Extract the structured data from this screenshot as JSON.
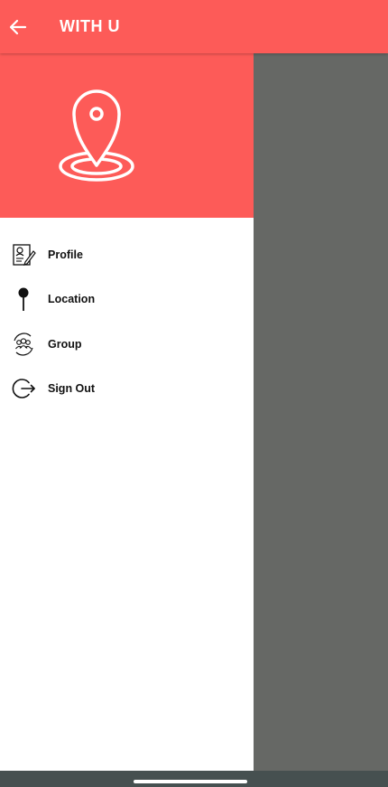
{
  "appbar": {
    "title": "WITH U",
    "back_icon": "arrow-left-icon",
    "color": "#fd5b58"
  },
  "drawer": {
    "header_icon": "location-pin-icon",
    "items": [
      {
        "label": "Profile",
        "icon": "profile-document-icon"
      },
      {
        "label": "Location",
        "icon": "pushpin-icon"
      },
      {
        "label": "Group",
        "icon": "group-people-icon"
      },
      {
        "label": "Sign Out",
        "icon": "sign-out-icon"
      }
    ]
  },
  "colors": {
    "accent": "#fd5b58",
    "scrim": "#666865",
    "drawer_bg": "#ffffff",
    "navbar": "#465050"
  }
}
